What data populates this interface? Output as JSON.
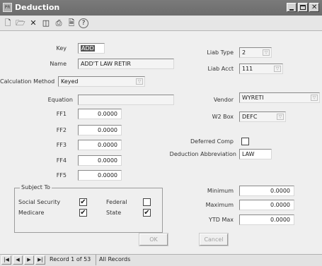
{
  "window": {
    "title": "Deduction",
    "app_icon_text": "PR"
  },
  "toolbar": {
    "icons": [
      "new-document-icon",
      "open-folder-icon",
      "delete-icon",
      "copy-icon",
      "print-icon",
      "print-preview-icon",
      "help-icon"
    ],
    "glyphs": [
      "🗋",
      "🗁",
      "✕",
      "◫",
      "⎙",
      "🗎",
      "?"
    ]
  },
  "form": {
    "key": {
      "label": "Key",
      "value": "ADD"
    },
    "name": {
      "label": "Name",
      "value": "ADD'T LAW RETIR"
    },
    "calc_method": {
      "label": "Calculation Method",
      "value": "Keyed"
    },
    "equation": {
      "label": "Equation",
      "value": ""
    },
    "ff": [
      {
        "label": "FF1",
        "value": "0.0000"
      },
      {
        "label": "FF2",
        "value": "0.0000"
      },
      {
        "label": "FF3",
        "value": "0.0000"
      },
      {
        "label": "FF4",
        "value": "0.0000"
      },
      {
        "label": "FF5",
        "value": "0.0000"
      }
    ],
    "liab_type": {
      "label": "Liab Type",
      "value": "2"
    },
    "liab_acct": {
      "label": "Liab Acct",
      "value": "111"
    },
    "vendor": {
      "label": "Vendor",
      "value": "WYRETI"
    },
    "w2_box": {
      "label": "W2 Box",
      "value": "DEFC"
    },
    "deferred_comp": {
      "label": "Deferred Comp",
      "checked": false
    },
    "deduction_abbrev": {
      "label": "Deduction Abbreviation",
      "value": "LAW"
    },
    "minimum": {
      "label": "Minimum",
      "value": "0.0000"
    },
    "maximum": {
      "label": "Maximum",
      "value": "0.0000"
    },
    "ytd_max": {
      "label": "YTD Max",
      "value": "0.0000"
    }
  },
  "subject_to": {
    "title": "Subject To",
    "items": [
      {
        "label": "Social Security",
        "checked": true
      },
      {
        "label": "Federal",
        "checked": false
      },
      {
        "label": "Medicare",
        "checked": true
      },
      {
        "label": "State",
        "checked": true
      }
    ]
  },
  "buttons": {
    "ok": "OK",
    "cancel": "Cancel"
  },
  "status": {
    "record": "Record 1 of 53",
    "filter": "All Records",
    "nav": [
      "|◀",
      "◀",
      "▶",
      "▶|"
    ]
  },
  "check_glyph": "✔",
  "dropdown_glyph": "▽"
}
